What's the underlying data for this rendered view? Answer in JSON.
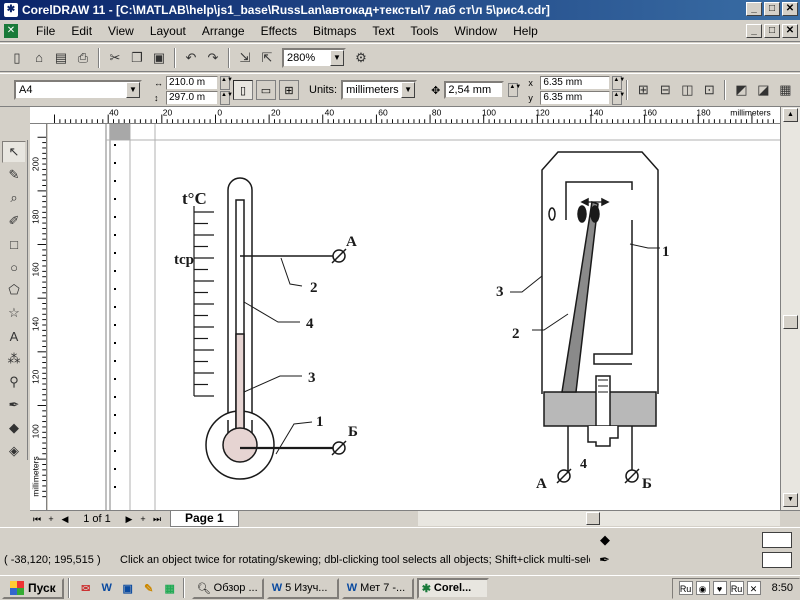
{
  "window": {
    "title": "CorelDRAW 11 - [C:\\MATLAB\\help\\js1_base\\RussLan\\автокад+тексты\\7 лаб ст\\л 5\\рис4.cdr]",
    "minimize": "_",
    "maximize": "□",
    "close": "✕"
  },
  "menu": [
    "File",
    "Edit",
    "View",
    "Layout",
    "Arrange",
    "Effects",
    "Bitmaps",
    "Text",
    "Tools",
    "Window",
    "Help"
  ],
  "toolbar": {
    "zoom": "280%"
  },
  "property_bar": {
    "page_size": "A4",
    "width": "210.0 m",
    "height": "297.0 m",
    "units_label": "Units:",
    "units": "millimeters",
    "nudge": "2,54 mm",
    "dup_x_label": "x",
    "dup_y_label": "y",
    "dup_x": "6.35 mm",
    "dup_y": "6.35 mm"
  },
  "hruler": {
    "labels": [
      "40",
      "20",
      "0",
      "20",
      "40",
      "60",
      "80",
      "100",
      "120",
      "140",
      "160",
      "180"
    ],
    "unit": "millimeters"
  },
  "vruler": {
    "labels": [
      "200",
      "180",
      "160",
      "140",
      "120",
      "100"
    ],
    "unit": "millimeters"
  },
  "page_nav": {
    "count": "1 of 1",
    "tab": "Page 1"
  },
  "drawing": {
    "thermo_unit": "t°C",
    "thermo_tcp": "tcp",
    "thermo_A": "А",
    "thermo_B": "Б",
    "thermo_labels": [
      "2",
      "4",
      "3",
      "1"
    ],
    "device_labels": [
      "1",
      "3",
      "2",
      "4"
    ],
    "device_A": "А",
    "device_B": "Б",
    "colors": {
      "fill_pink": "#e6d4d2",
      "line": "#1a1a1a"
    }
  },
  "status": {
    "coords": "( -38,120; 195,515 )",
    "message": "Click an object twice for rotating/skewing; dbl-clicking tool selects all objects; Shift+click multi-sele..."
  },
  "taskbar": {
    "start": "Пуск",
    "tasks": [
      {
        "label": "Обзор ...",
        "icon": "explorer-icon"
      },
      {
        "label": "5 Изуч...",
        "icon": "word-icon"
      },
      {
        "label": "Мет 7 -...",
        "icon": "word-icon"
      },
      {
        "label": "Corel...",
        "icon": "corel-icon"
      }
    ],
    "lang1": "Ru",
    "lang2": "Ru",
    "clock": "8:50"
  }
}
